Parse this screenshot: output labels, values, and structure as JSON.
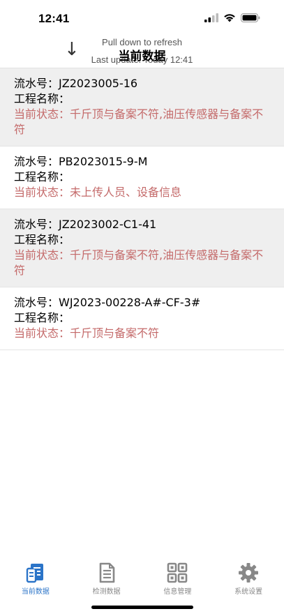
{
  "status_bar": {
    "time": "12:41"
  },
  "refresh": {
    "title": "Pull down to refresh",
    "subtitle": "Last update: Today 12:41",
    "arrow": "↓"
  },
  "nav": {
    "title": "当前数据"
  },
  "records": [
    {
      "serial_label": "流水号：",
      "serial": "JZ2023005-16",
      "project_label": "工程名称：",
      "project": "",
      "status_label": "当前状态：",
      "status": "千斤顶与备案不符,油压传感器与备案不符"
    },
    {
      "serial_label": "流水号：",
      "serial": "PB2023015-9-M",
      "project_label": "工程名称：",
      "project": "",
      "status_label": "当前状态：",
      "status": "未上传人员、设备信息"
    },
    {
      "serial_label": "流水号：",
      "serial": "JZ2023002-C1-41",
      "project_label": "工程名称：",
      "project": "",
      "status_label": "当前状态：",
      "status": "千斤顶与备案不符,油压传感器与备案不符"
    },
    {
      "serial_label": "流水号：",
      "serial": "WJ2023-00228-A#-CF-3#",
      "project_label": "工程名称：",
      "project": "",
      "status_label": "当前状态：",
      "status": "千斤顶与备案不符"
    }
  ],
  "tabs": [
    {
      "label": "当前数据",
      "icon": "document-list-icon",
      "active": true
    },
    {
      "label": "检测数据",
      "icon": "document-icon",
      "active": false
    },
    {
      "label": "信息管理",
      "icon": "grid-icon",
      "active": false
    },
    {
      "label": "系统设置",
      "icon": "gear-icon",
      "active": false
    }
  ],
  "colors": {
    "accent": "#2b74c8",
    "status_text": "#c46a6a",
    "inactive_icon": "#888888",
    "row_shade": "#efefef"
  }
}
